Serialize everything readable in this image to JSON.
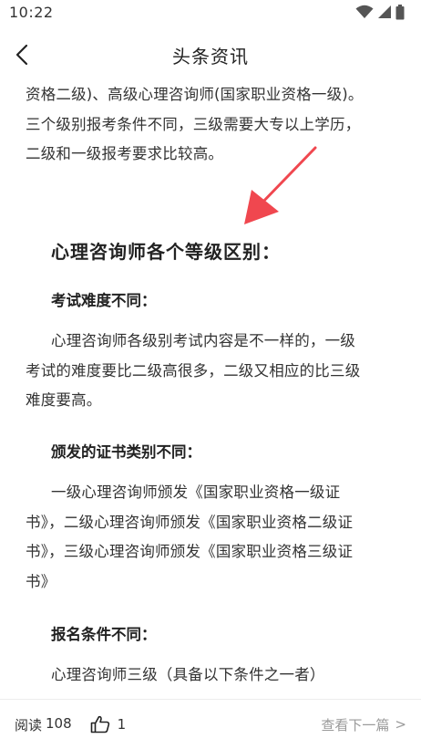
{
  "status_bar": {
    "time": "10:22"
  },
  "header": {
    "title": "头条资讯"
  },
  "article": {
    "intro_lines": [
      "资格二级)、高级心理咨询师(国家职业资格一级)。",
      "三个级别报考条件不同，三级需要大专以上学历，",
      "二级和一级报考要求比较高。"
    ],
    "section_title": "心理咨询师各个等级区别：",
    "difficulty": {
      "heading": "考试难度不同：",
      "lines": [
        "心理咨询师各级别考试内容是不一样的，一级",
        "考试的难度要比二级高很多，二级又相应的比三级",
        "难度要高。"
      ]
    },
    "certificate": {
      "heading": "颁发的证书类别不同：",
      "lines": [
        "一级心理咨询师颁发《国家职业资格一级证",
        "书》，二级心理咨询师颁发《国家职业资格二级证",
        "书》，三级心理咨询师颁发《国家职业资格三级证",
        "书》"
      ]
    },
    "registration": {
      "heading": "报名条件不同：",
      "lines": [
        "心理咨询师三级（具备以下条件之一者）"
      ]
    },
    "annotation_color": "#f0474f"
  },
  "footer": {
    "read_label": "阅读",
    "read_count": "108",
    "like_count": "1",
    "next_label": "查看下一篇",
    "next_chevron": ">"
  }
}
